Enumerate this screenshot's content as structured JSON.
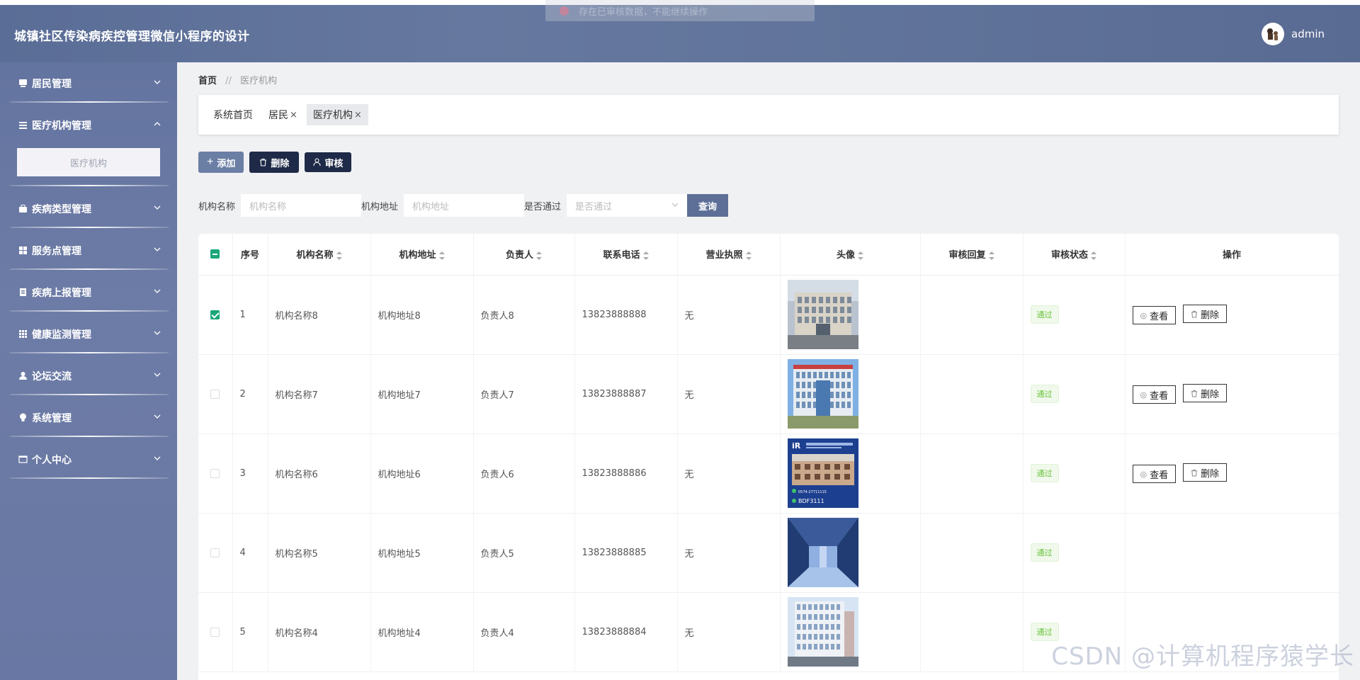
{
  "app": {
    "title": "城镇社区传染病疾控管理微信小程序的设计",
    "user": "admin"
  },
  "toast": {
    "message": "存在已审核数据，不能继续操作"
  },
  "sidebar": {
    "items": [
      {
        "label": "居民管理",
        "icon": "resident-icon"
      },
      {
        "label": "医疗机构管理",
        "icon": "list-icon",
        "open": true,
        "sub": [
          {
            "label": "医疗机构"
          }
        ]
      },
      {
        "label": "疾病类型管理",
        "icon": "briefcase-icon"
      },
      {
        "label": "服务点管理",
        "icon": "grid-icon"
      },
      {
        "label": "疾病上报管理",
        "icon": "report-icon"
      },
      {
        "label": "健康监测管理",
        "icon": "table-icon"
      },
      {
        "label": "论坛交流",
        "icon": "user-icon"
      },
      {
        "label": "系统管理",
        "icon": "bulb-icon"
      },
      {
        "label": "个人中心",
        "icon": "window-icon"
      }
    ]
  },
  "breadcrumb": {
    "home": "首页",
    "separator": "//",
    "current": "医疗机构"
  },
  "tabs": [
    {
      "label": "系统首页",
      "closable": false
    },
    {
      "label": "居民",
      "closable": true
    },
    {
      "label": "医疗机构",
      "closable": true,
      "active": true
    }
  ],
  "toolbar": {
    "add": "添加",
    "delete": "删除",
    "audit": "审核"
  },
  "search": {
    "name_label": "机构名称",
    "name_placeholder": "机构名称",
    "address_label": "机构地址",
    "address_placeholder": "机构地址",
    "passed_label": "是否通过",
    "passed_placeholder": "是否通过",
    "query": "查询"
  },
  "table": {
    "columns": [
      "序号",
      "机构名称",
      "机构地址",
      "负责人",
      "联系电话",
      "营业执照",
      "头像",
      "审核回复",
      "审核状态",
      "操作"
    ],
    "rows": [
      {
        "index": "1",
        "name": "机构名称8",
        "address": "机构地址8",
        "owner": "负责人8",
        "phone": "13823888888",
        "license": "无",
        "reply": "",
        "status": "通过",
        "checked": true,
        "ops": true
      },
      {
        "index": "2",
        "name": "机构名称7",
        "address": "机构地址7",
        "owner": "负责人7",
        "phone": "13823888887",
        "license": "无",
        "reply": "",
        "status": "通过",
        "checked": false,
        "ops": true
      },
      {
        "index": "3",
        "name": "机构名称6",
        "address": "机构地址6",
        "owner": "负责人6",
        "phone": "13823888886",
        "license": "无",
        "reply": "",
        "status": "通过",
        "checked": false,
        "ops": true
      },
      {
        "index": "4",
        "name": "机构名称5",
        "address": "机构地址5",
        "owner": "负责人5",
        "phone": "13823888885",
        "license": "无",
        "reply": "",
        "status": "通过",
        "checked": false,
        "ops": false
      },
      {
        "index": "5",
        "name": "机构名称4",
        "address": "机构地址4",
        "owner": "负责人4",
        "phone": "13823888884",
        "license": "无",
        "reply": "",
        "status": "通过",
        "checked": false,
        "ops": false
      }
    ],
    "view_label": "查看",
    "delete_label": "删除"
  },
  "thumb3": {
    "phone": "0574-27711115",
    "code": "BDF3111"
  },
  "watermark": "CSDN @计算机程序猿学长",
  "colors": {
    "header": "#5f7299",
    "sidebar": "#6877a3",
    "accent_green": "#1aa77a",
    "dark_button": "#1e2a47"
  }
}
